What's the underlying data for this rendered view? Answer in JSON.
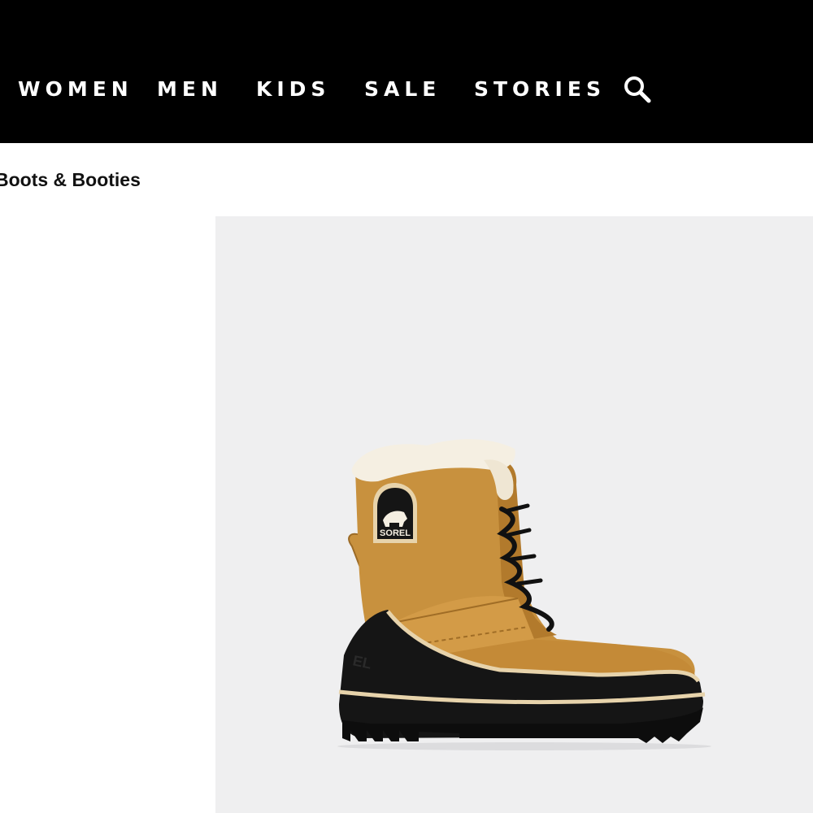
{
  "nav": {
    "items": [
      {
        "label": "WOMEN"
      },
      {
        "label": "MEN"
      },
      {
        "label": "KIDS"
      },
      {
        "label": "SALE"
      },
      {
        "label": "STORIES"
      }
    ],
    "search_icon": "search-icon"
  },
  "breadcrumb": {
    "current": "Boots & Booties"
  },
  "product": {
    "image_subject": "boot-image",
    "logo_text": "SOREL",
    "colors": {
      "panel_bg": "#efeff0",
      "suede": "#c8913e",
      "rubber": "#151515",
      "fur": "#f5efe2",
      "trim": "#e7d3ab"
    }
  },
  "colors": {
    "header_bg": "#000000",
    "header_text": "#ffffff"
  }
}
